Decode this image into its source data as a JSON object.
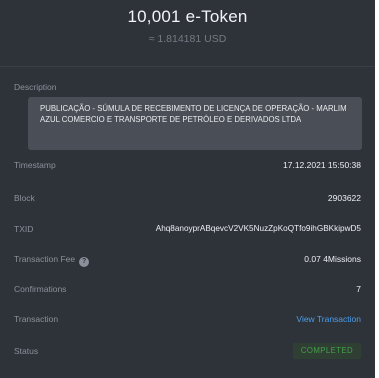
{
  "header": {
    "amount": "10,001 e-Token",
    "fiat": "≈ 1.814181 USD"
  },
  "description": {
    "label": "Description",
    "text": "PUBLICAÇÃO - SÚMULA DE RECEBIMENTO DE LICENÇA DE OPERAÇÃO - MARLIM AZUL COMERCIO E TRANSPORTE DE PETRÓLEO E DERIVADOS LTDA"
  },
  "rows": {
    "timestamp": {
      "label": "Timestamp",
      "value": "17.12.2021 15:50:38"
    },
    "block": {
      "label": "Block",
      "value": "2903622"
    },
    "txid": {
      "label": "TXID",
      "value": "Ahq8anoyprABqevcV2VK5NuzZpKoQTfo9ihGBKkipwD5"
    },
    "fee": {
      "label": "Transaction Fee",
      "help_glyph": "?",
      "value": "0.07 4Missions"
    },
    "confirmations": {
      "label": "Confirmations",
      "value": "7"
    },
    "transaction": {
      "label": "Transaction",
      "link": "View Transaction"
    },
    "status": {
      "label": "Status",
      "value": "COMPLETED"
    }
  },
  "colors": {
    "background": "#2e3239",
    "link": "#4d9ee8",
    "status_completed": "#43a049"
  }
}
